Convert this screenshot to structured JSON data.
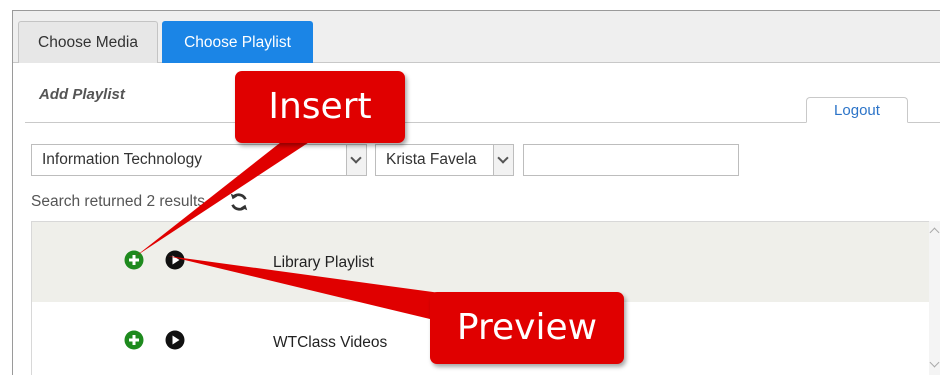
{
  "tabs": [
    {
      "label": "Choose Media",
      "active": false
    },
    {
      "label": "Choose Playlist",
      "active": true
    }
  ],
  "panel": {
    "title": "Add Playlist",
    "logout_label": "Logout"
  },
  "filters": {
    "department": {
      "selected": "Information Technology"
    },
    "owner": {
      "selected": "Krista Favela"
    },
    "search": {
      "value": "",
      "placeholder": ""
    }
  },
  "results": {
    "status_text": "Search returned 2 results",
    "refresh_icon": "refresh-icon",
    "items": [
      {
        "title": "Library Playlist",
        "insert_icon": "plus-circle-icon",
        "preview_icon": "play-circle-icon"
      },
      {
        "title": "WTClass Videos",
        "insert_icon": "plus-circle-icon",
        "preview_icon": "play-circle-icon"
      }
    ]
  },
  "annotations": {
    "insert": "Insert",
    "preview": "Preview"
  },
  "colors": {
    "active_tab": "#1b85e6",
    "insert_icon": "#1e8a1e",
    "callout": "#e00000",
    "link": "#2c74c8"
  }
}
